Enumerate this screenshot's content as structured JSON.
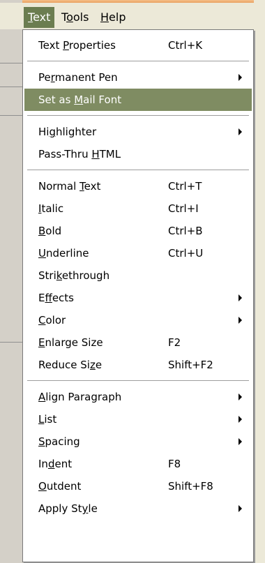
{
  "menubar": {
    "items": [
      {
        "label": "Text",
        "mnemonic": "T",
        "rest": "ext"
      },
      {
        "label": "Tools",
        "pre": "T",
        "mnemonic": "o",
        "rest": "ols"
      },
      {
        "label": "Help",
        "mnemonic": "H",
        "rest": "elp"
      }
    ]
  },
  "menu": {
    "items": [
      {
        "pre": "Text ",
        "mn": "P",
        "post": "roperties",
        "shortcut": "Ctrl+K",
        "submenu": false
      },
      {
        "separator": true
      },
      {
        "pre": "Pe",
        "mn": "r",
        "post": "manent Pen",
        "shortcut": "",
        "submenu": true
      },
      {
        "pre": "Set as ",
        "mn": "M",
        "post": "ail Font",
        "shortcut": "",
        "submenu": false,
        "highlighted": true
      },
      {
        "separator": true
      },
      {
        "pre": "Hi",
        "mn": "g",
        "post": "hlighter",
        "shortcut": "",
        "submenu": true
      },
      {
        "pre": "Pass-Thru ",
        "mn": "H",
        "post": "TML",
        "shortcut": "",
        "submenu": false
      },
      {
        "separator": true
      },
      {
        "pre": "Normal ",
        "mn": "T",
        "post": "ext",
        "shortcut": "Ctrl+T",
        "submenu": false
      },
      {
        "pre": "",
        "mn": "I",
        "post": "talic",
        "shortcut": "Ctrl+I",
        "submenu": false
      },
      {
        "pre": "",
        "mn": "B",
        "post": "old",
        "shortcut": "Ctrl+B",
        "submenu": false
      },
      {
        "pre": "",
        "mn": "U",
        "post": "nderline",
        "shortcut": "Ctrl+U",
        "submenu": false
      },
      {
        "pre": "Stri",
        "mn": "k",
        "post": "ethrough",
        "shortcut": "",
        "submenu": false
      },
      {
        "pre": "E",
        "mn": "f",
        "post": "fects",
        "shortcut": "",
        "submenu": true
      },
      {
        "pre": "",
        "mn": "C",
        "post": "olor",
        "shortcut": "",
        "submenu": true
      },
      {
        "pre": "",
        "mn": "E",
        "post": "nlarge Size",
        "shortcut": "F2",
        "submenu": false
      },
      {
        "pre": "Reduce Si",
        "mn": "z",
        "post": "e",
        "shortcut": "Shift+F2",
        "submenu": false
      },
      {
        "separator": true
      },
      {
        "pre": "",
        "mn": "A",
        "post": "lign Paragraph",
        "shortcut": "",
        "submenu": true
      },
      {
        "pre": "",
        "mn": "L",
        "post": "ist",
        "shortcut": "",
        "submenu": true
      },
      {
        "pre": "",
        "mn": "S",
        "post": "pacing",
        "shortcut": "",
        "submenu": true
      },
      {
        "pre": "In",
        "mn": "d",
        "post": "ent",
        "shortcut": "F8",
        "submenu": false
      },
      {
        "pre": "",
        "mn": "O",
        "post": "utdent",
        "shortcut": "Shift+F8",
        "submenu": false
      },
      {
        "pre": "Apply St",
        "mn": "y",
        "post": "le",
        "shortcut": "",
        "submenu": true
      }
    ]
  },
  "colors": {
    "highlight": "#7f8c62",
    "menubar_active": "#6b7d50",
    "menu_bg": "#ffffff",
    "chrome_bg": "#ece9d8"
  }
}
